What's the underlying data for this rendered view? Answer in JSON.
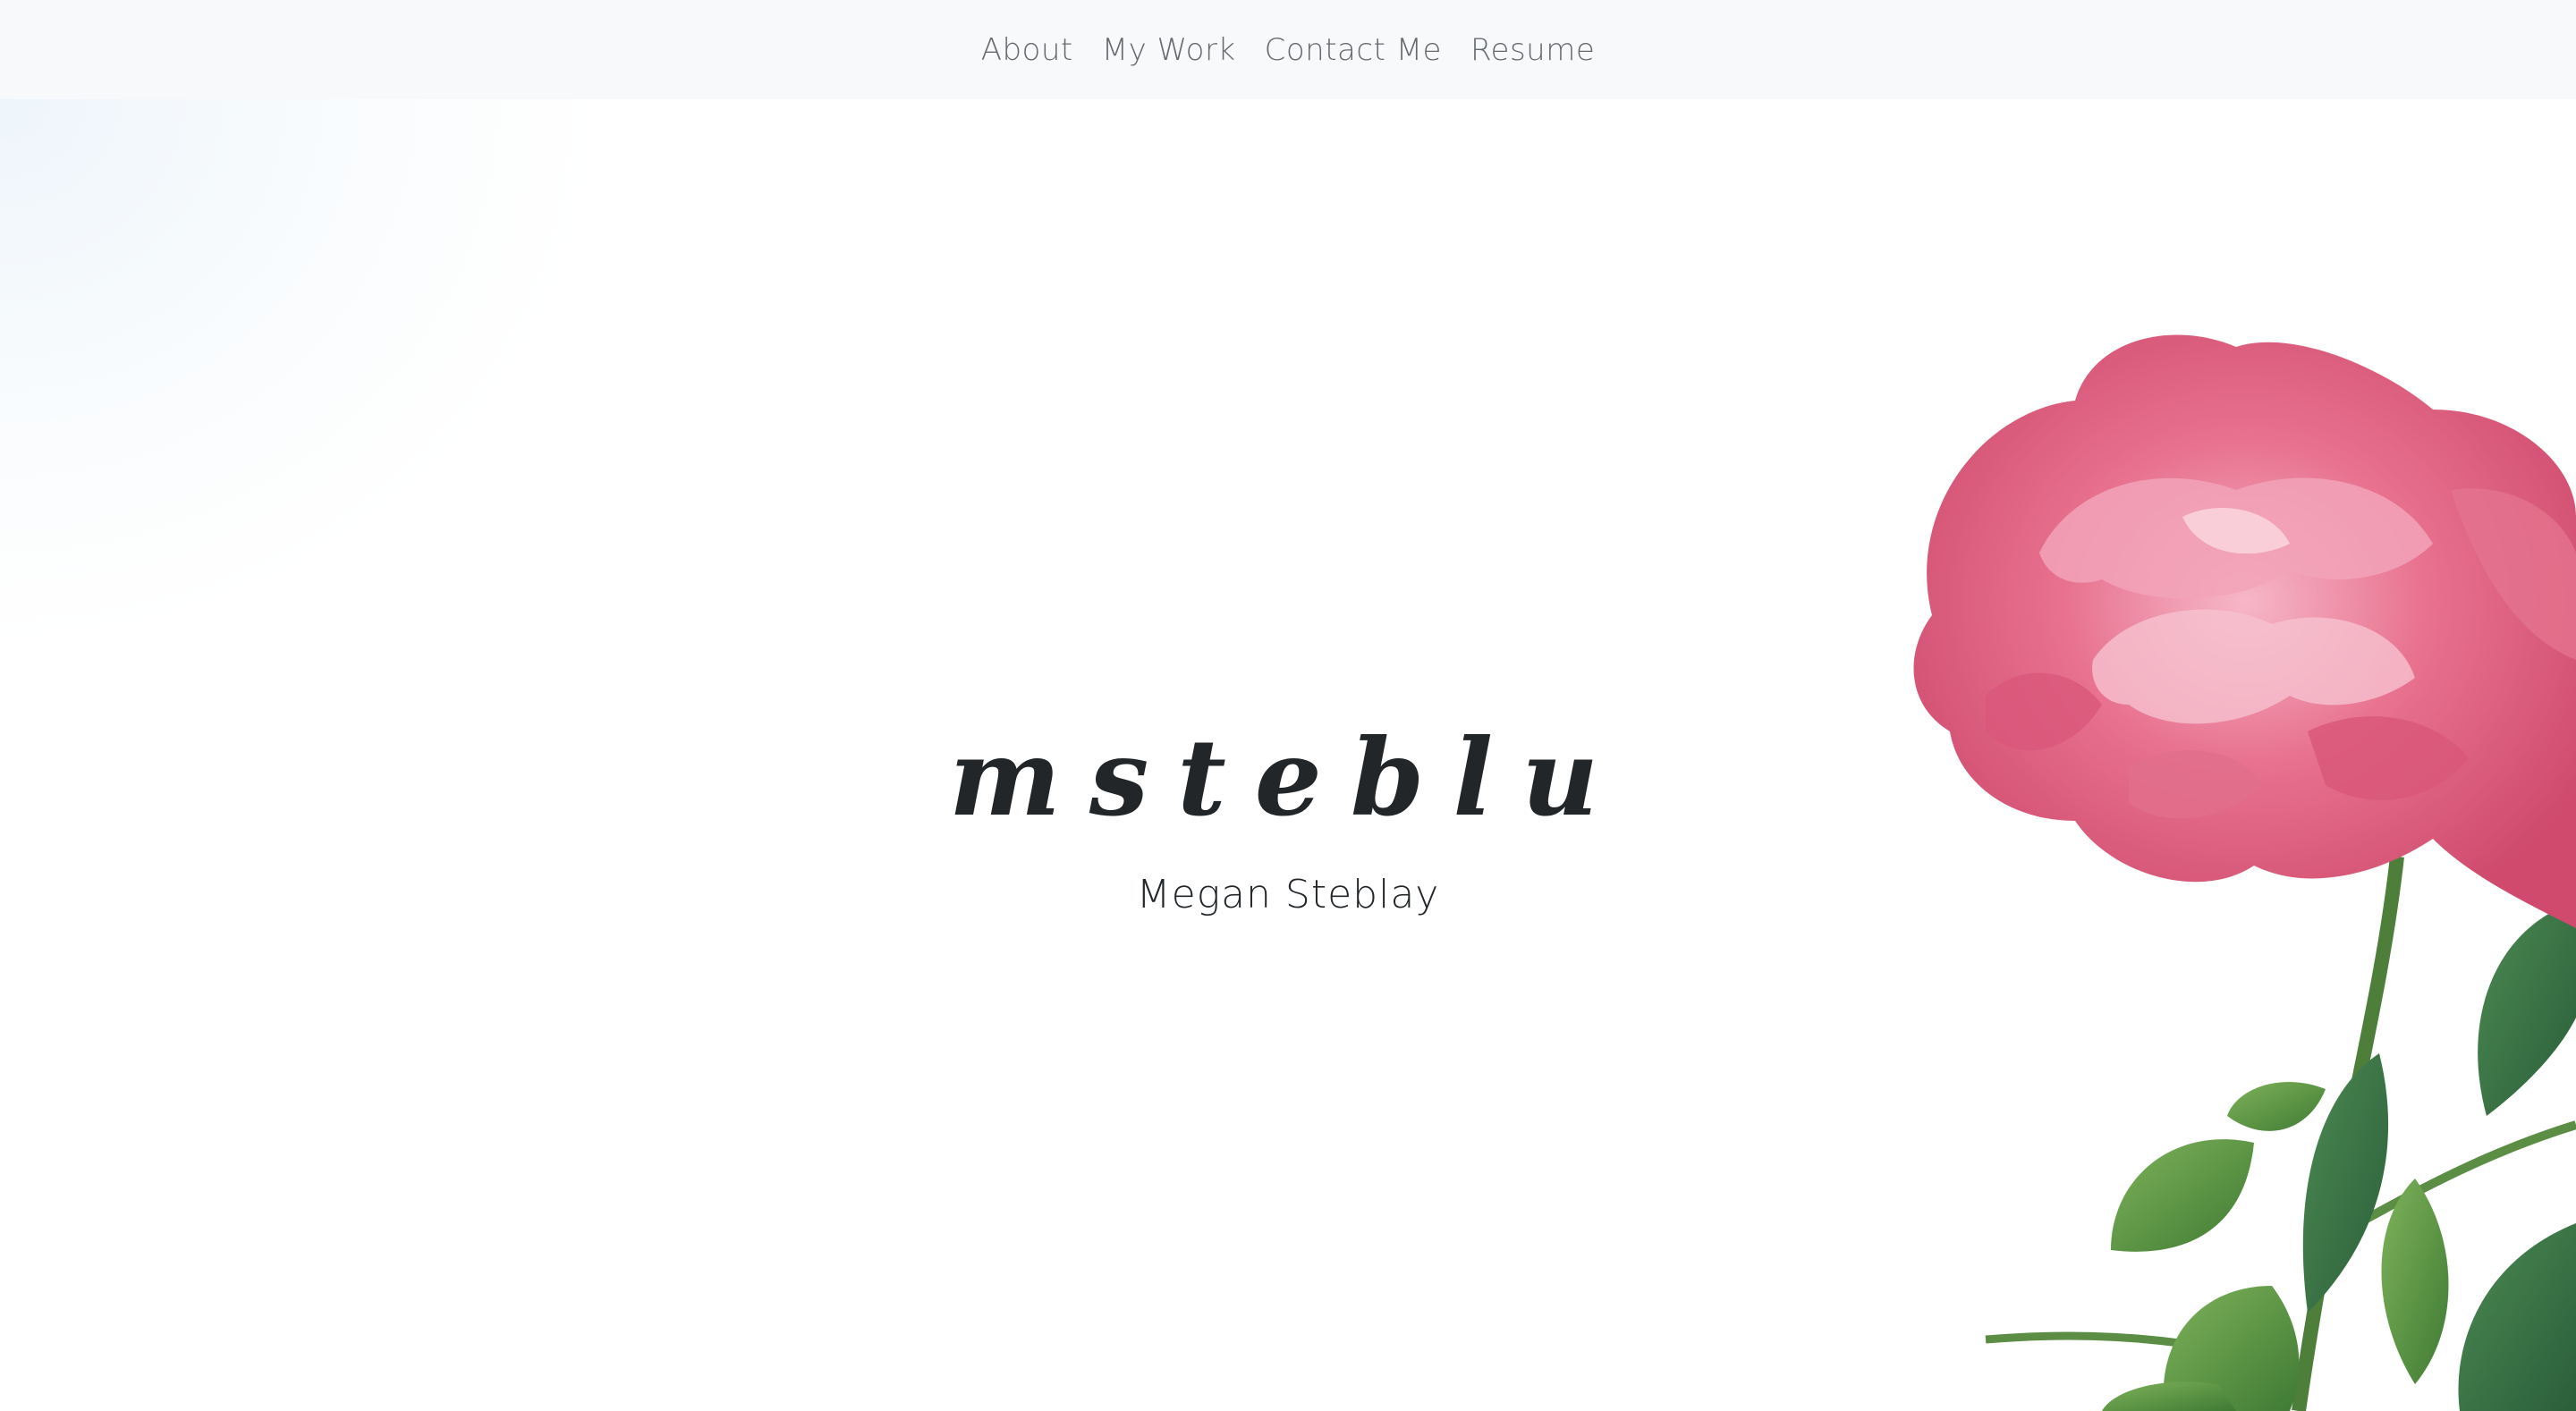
{
  "nav": {
    "items": [
      {
        "label": "About"
      },
      {
        "label": "My Work"
      },
      {
        "label": "Contact Me"
      },
      {
        "label": "Resume"
      }
    ]
  },
  "hero": {
    "logo_text": "msteblu",
    "subtitle": "Megan Steblay",
    "image": "pink-rose-with-green-leaves"
  },
  "colors": {
    "navbar_bg": "#f8f9fa",
    "nav_text": "#666a6e",
    "heading_text": "#222629",
    "rose_pink": "#e05a7e",
    "leaf_green": "#4e8a3a"
  }
}
